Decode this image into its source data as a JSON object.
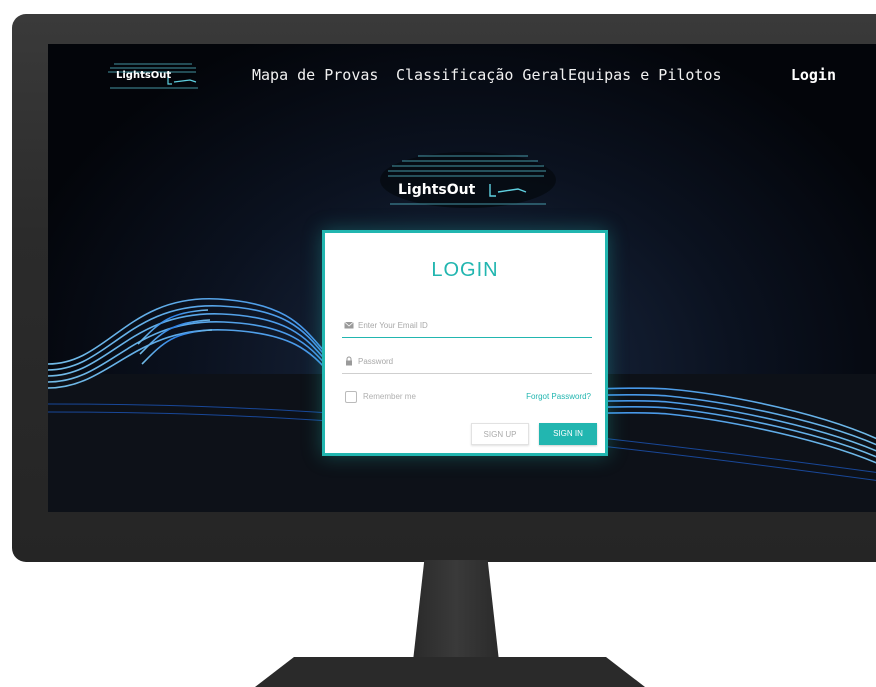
{
  "nav": {
    "logo_text": "LightsOut",
    "links": [
      "Mapa de Provas",
      "Classificação Geral",
      "Equipas e Pilotos"
    ],
    "login_label": "Login"
  },
  "hero": {
    "logo_text": "LightsOut"
  },
  "login_form": {
    "title": "LOGIN",
    "email_placeholder": "Enter Your Email ID",
    "password_placeholder": "Password",
    "remember_label": "Remember me",
    "forgot_label": "Forgot Password?",
    "signup_label": "SIGN UP",
    "signin_label": "SIGN IN"
  },
  "colors": {
    "accent": "#22b6b0",
    "light_trails": "#2f8cff"
  }
}
